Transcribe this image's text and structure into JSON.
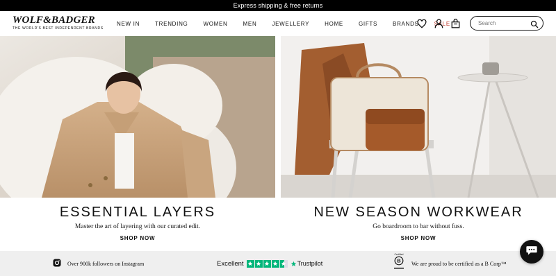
{
  "announcement": "Express shipping & free returns",
  "logo": {
    "main": "WOLF&BADGER",
    "tagline": "THE WORLD'S BEST INDEPENDENT BRANDS"
  },
  "nav": [
    {
      "label": "NEW IN"
    },
    {
      "label": "TRENDING"
    },
    {
      "label": "WOMEN"
    },
    {
      "label": "MEN"
    },
    {
      "label": "JEWELLERY"
    },
    {
      "label": "HOME"
    },
    {
      "label": "GIFTS"
    },
    {
      "label": "BRANDS"
    },
    {
      "label": "SALE"
    }
  ],
  "icons": [
    "heart-icon",
    "user-icon",
    "bag-icon",
    "search-icon",
    "chat-icon",
    "instagram-icon",
    "trustpilot-star-icon",
    "bcorp-icon"
  ],
  "search": {
    "placeholder": "Search"
  },
  "heroes": [
    {
      "title": "ESSENTIAL LAYERS",
      "subtitle": "Master the art of layering with our curated edit.",
      "cta": "SHOP NOW"
    },
    {
      "title": "NEW SEASON WORKWEAR",
      "subtitle": "Go boardroom to bar without fuss.",
      "cta": "SHOP NOW"
    }
  ],
  "trust": {
    "instagram": "Over 900k followers on Instagram",
    "trustpilot_rating_label": "Excellent",
    "trustpilot_brand": "Trustpilot",
    "trustpilot_stars": 4.5,
    "bcorp_certified": "Certified",
    "bcorp_text": "We are proud to be certified as a B Corp™"
  },
  "colors": {
    "sale": "#c0392b",
    "trustpilot_green": "#00b67a",
    "trust_bar": "#efefef"
  }
}
